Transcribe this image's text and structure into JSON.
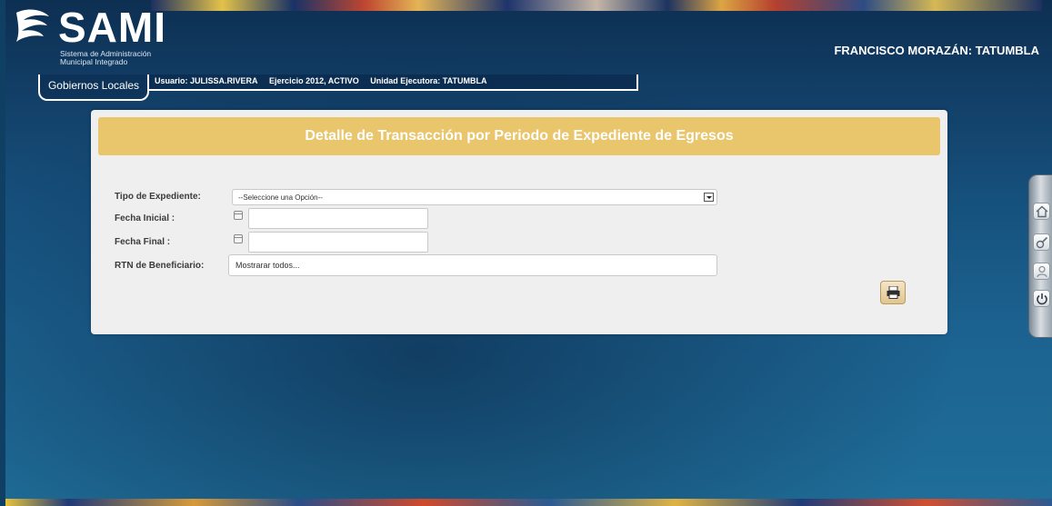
{
  "header": {
    "logo_title": "SAMI",
    "logo_subtitle_line1": "Sistema de Administración",
    "logo_subtitle_line2": "Municipal Integrado",
    "entity": "FRANCISCO MORAZÁN: TATUMBLA"
  },
  "session": {
    "tab_label": "Gobiernos Locales",
    "user": "Usuario: JULISSA.RIVERA",
    "fiscal_year": "Ejercicio 2012, ACTIVO",
    "unit": "Unidad Ejecutora: TATUMBLA"
  },
  "form": {
    "title": "Detalle de Transacción por Periodo de Expediente de Egresos",
    "tipo_label": "Tipo de Expediente:",
    "tipo_value": "--Seleccione una Opción--",
    "fecha_inicial_label": "Fecha Inicial :",
    "fecha_inicial_value": "",
    "fecha_final_label": "Fecha Final :",
    "fecha_final_value": "",
    "rtn_label": "RTN de Beneficiario:",
    "rtn_value": "Mostrarar todos..."
  },
  "icons": {
    "logo": "sami-logo-icon",
    "calendar": "calendar-icon",
    "print": "print-icon",
    "dock": [
      "home-icon",
      "tools-icon",
      "user-icon",
      "power-icon"
    ]
  },
  "colors": {
    "panel_header": "#e9c56c",
    "panel_bg": "#efefef",
    "background": "#16517d"
  }
}
